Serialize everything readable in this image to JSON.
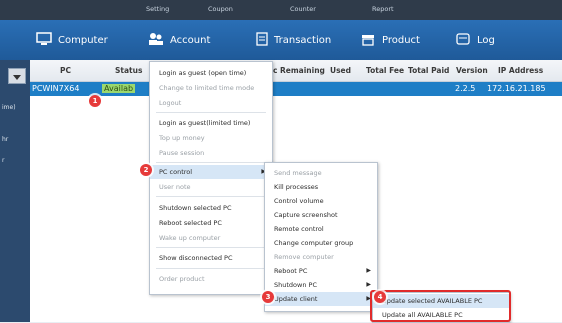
{
  "topbar": {
    "setting": "Setting",
    "coupon": "Coupon",
    "counter": "Counter",
    "report": "Report"
  },
  "nav": {
    "computer": "Computer",
    "account": "Account",
    "transaction": "Transaction",
    "product": "Product",
    "log": "Log"
  },
  "left": {
    "label1": "ime)",
    "label2": "hr",
    "label3": "r"
  },
  "columns": {
    "pc": "PC",
    "status": "Status",
    "c": "c",
    "remaining": "Remaining",
    "used": "Used",
    "total_fee": "Total Fee",
    "total_paid": "Total Paid",
    "version": "Version",
    "ip": "IP Address"
  },
  "row": {
    "pc": "PCWIN7X64",
    "status": "Availab",
    "version": "2.2.5",
    "ip": "172.16.21.185"
  },
  "menu1": {
    "items": [
      "Login as guest (open time)",
      "Change to limited time mode",
      "Logout",
      "Login as guest(limited time)",
      "Top up money",
      "Pause session",
      "PC control",
      "User note",
      "Shutdown selected PC",
      "Reboot selected PC",
      "Wake up computer",
      "Show disconnected PC",
      "Order product"
    ]
  },
  "menu2": {
    "items": [
      "Send message",
      "Kill processes",
      "Control volume",
      "Capture screenshot",
      "Remote control",
      "Change computer group",
      "Remove computer",
      "Reboot PC",
      "Shutdown PC",
      "Update client"
    ]
  },
  "menu3": {
    "items": [
      "Update selected AVAILABLE PC",
      "Update all AVAILABLE PC"
    ]
  },
  "steps": [
    "1",
    "2",
    "3",
    "4"
  ],
  "colors": {
    "nav": "#2a6fb6",
    "selected_row": "#1e7ec6",
    "highlight": "#e02b2b"
  }
}
